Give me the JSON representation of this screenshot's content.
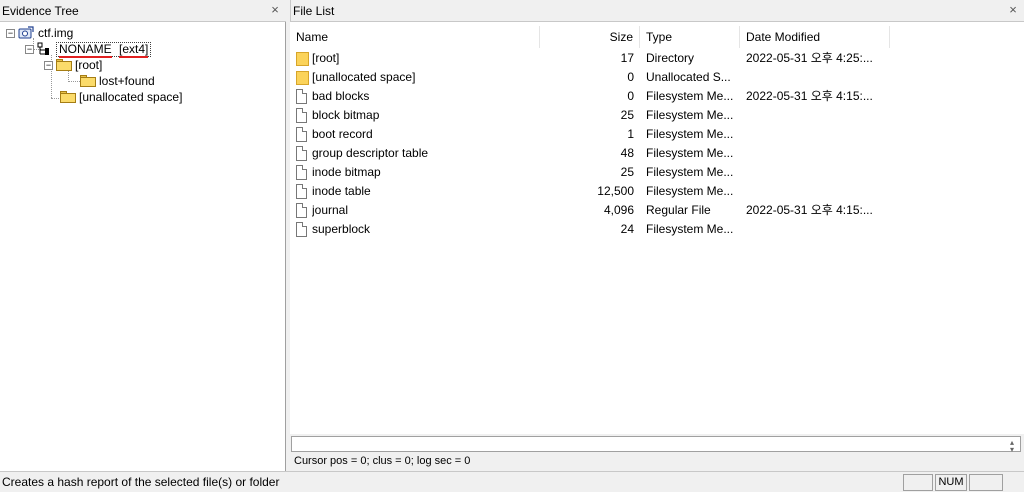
{
  "evidence_tree": {
    "title": "Evidence Tree",
    "close_icon": "×",
    "nodes": {
      "image": "ctf.img",
      "volume_name": "NONAME",
      "volume_fs": "[ext4]",
      "root": "[root]",
      "lost_found": "lost+found",
      "unallocated": "[unallocated space]"
    }
  },
  "file_list": {
    "title": "File List",
    "close_icon": "×",
    "columns": {
      "name": "Name",
      "size": "Size",
      "type": "Type",
      "date": "Date Modified"
    },
    "rows": [
      {
        "icon": "folder-icon",
        "name": "[root]",
        "size": "17",
        "type": "Directory",
        "date": "2022-05-31 오후 4:25:..."
      },
      {
        "icon": "folder-icon",
        "name": "[unallocated space]",
        "size": "0",
        "type": "Unallocated S...",
        "date": ""
      },
      {
        "icon": "file-icon",
        "name": "bad blocks",
        "size": "0",
        "type": "Filesystem Me...",
        "date": "2022-05-31 오후 4:15:..."
      },
      {
        "icon": "file-icon",
        "name": "block bitmap",
        "size": "25",
        "type": "Filesystem Me...",
        "date": ""
      },
      {
        "icon": "file-icon",
        "name": "boot record",
        "size": "1",
        "type": "Filesystem Me...",
        "date": ""
      },
      {
        "icon": "file-icon",
        "name": "group descriptor table",
        "size": "48",
        "type": "Filesystem Me...",
        "date": ""
      },
      {
        "icon": "file-icon",
        "name": "inode bitmap",
        "size": "25",
        "type": "Filesystem Me...",
        "date": ""
      },
      {
        "icon": "file-icon",
        "name": "inode table",
        "size": "12,500",
        "type": "Filesystem Me...",
        "date": ""
      },
      {
        "icon": "file-icon",
        "name": "journal",
        "size": "4,096",
        "type": "Regular File",
        "date": "2022-05-31 오후 4:15:..."
      },
      {
        "icon": "file-icon",
        "name": "superblock",
        "size": "24",
        "type": "Filesystem Me...",
        "date": ""
      }
    ]
  },
  "hex_view": {
    "cursor_info": "Cursor pos = 0; clus = 0; log sec = 0"
  },
  "status_bar": {
    "message": "Creates a hash report of the selected file(s) or folder",
    "num_indicator": "NUM"
  },
  "colors": {
    "folder": "#fbd35a",
    "underline": "#e02020",
    "selection_border": "#404040"
  }
}
